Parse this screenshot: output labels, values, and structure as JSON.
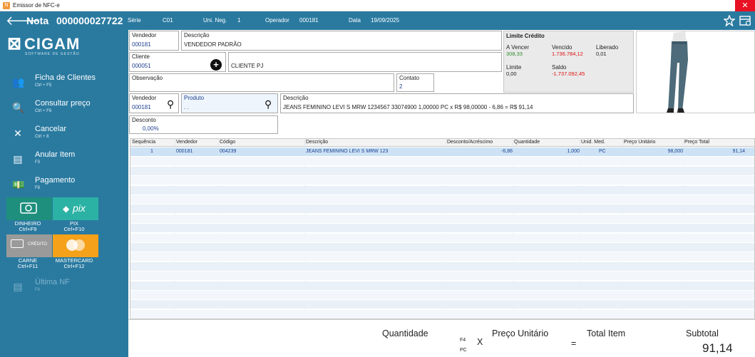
{
  "window": {
    "title": "Emissor de NFC-e",
    "close": "✕"
  },
  "header": {
    "back": "🡐",
    "nota_label": "Nota",
    "nota_number": "000000027722",
    "serie_label": "Série",
    "serie_value": "C01",
    "unineg_label": "Uni. Neg.",
    "unineg_value": "1",
    "operador_label": "Operador",
    "operador_value": "000181",
    "data_label": "Data",
    "data_value": "19/09/2025"
  },
  "logo": {
    "mark": "⊠",
    "name": "CIGAM",
    "tagline": "SOFTWARE DE GESTÃO"
  },
  "sidebar": {
    "items": [
      {
        "label": "Ficha de Clientes",
        "shortcut": "Ctrl + F5",
        "icon": "👥"
      },
      {
        "label": "Consultar preço",
        "shortcut": "Ctrl + F6",
        "icon": "🔍"
      },
      {
        "label": "Cancelar",
        "shortcut": "Ctrl + 8",
        "icon": "✕"
      },
      {
        "label": "Anular Item",
        "shortcut": "F3",
        "icon": "▤"
      },
      {
        "label": "Pagamento",
        "shortcut": "F8",
        "icon": "💵"
      },
      {
        "label": "Última NF",
        "shortcut": "F8",
        "icon": "▤"
      }
    ],
    "payments": [
      {
        "label": "DINHEIRO",
        "shortcut": "Ctrl+F9",
        "badge": ""
      },
      {
        "label": "PIX",
        "shortcut": "Ctrl+F10",
        "badge": "pix"
      },
      {
        "label": "CARNE",
        "shortcut": "Ctrl+F11",
        "badge": "CRÉDITO"
      },
      {
        "label": "MASTERCARD",
        "shortcut": "Ctrl+F12",
        "badge": ""
      }
    ]
  },
  "form": {
    "vendedor_label": "Vendedor",
    "vendedor_value": "000181",
    "descricao_label": "Descrição",
    "descricao_value": "VENDEDOR PADRÃO",
    "cliente_label": "Cliente",
    "cliente_value": "000051",
    "cliente_name": "CLIENTE PJ",
    "observacao_label": "Observação",
    "contato_label": "Contato",
    "contato_value": "2",
    "vendedor2_label": "Vendedor",
    "vendedor2_value": "000181",
    "produto_label": "Produto",
    "produto_value": ". .",
    "descricao2_label": "Descrição",
    "descricao2_value": "JEANS FEMININO LEVI S MRW  1234567  33074900 1,00000 PC x R$ 98,00000 - 6,86 = R$ 91,14",
    "desconto_label": "Desconto",
    "desconto_value": "0,00%"
  },
  "limite": {
    "title": "Limite Crédito",
    "a_vencer_label": "A Vencer",
    "a_vencer_value": "308,33",
    "vencido_label": "Vencido",
    "vencido_value": "1.736.784,12",
    "liberado_label": "Liberado",
    "liberado_value": "0,01",
    "limite_label": "Limite",
    "limite_value": "0,00",
    "saldo_label": "Saldo",
    "saldo_value": "-1.737.092,45"
  },
  "table": {
    "headers": [
      "Sequência",
      "Vendedor",
      "Código",
      "Descrição",
      "Desconto/Acréscimo",
      "Quantidade",
      "Unid. Med.",
      "Preço Unitário",
      "Preço Total"
    ],
    "rows": [
      [
        "1",
        "000181",
        "004239",
        "JEANS FEMININO LEVI S MRW  123",
        "-6,86",
        "1,000",
        "PC",
        "98,000",
        "91,14"
      ]
    ]
  },
  "footer": {
    "quantidade_label": "Quantidade",
    "f4": "F4",
    "pc": "PC",
    "x": "X",
    "preco_label": "Preço Unitário",
    "eq": "=",
    "total_label": "Total Item",
    "subtotal_label": "Subtotal",
    "subtotal_value": "91,14"
  },
  "colors": {
    "accent": "#2a7aa0",
    "pix": "#2bb2a4",
    "dinheiro": "#1e8f7d",
    "mastercard": "#f5a11a",
    "carne": "#9a9a9a"
  }
}
